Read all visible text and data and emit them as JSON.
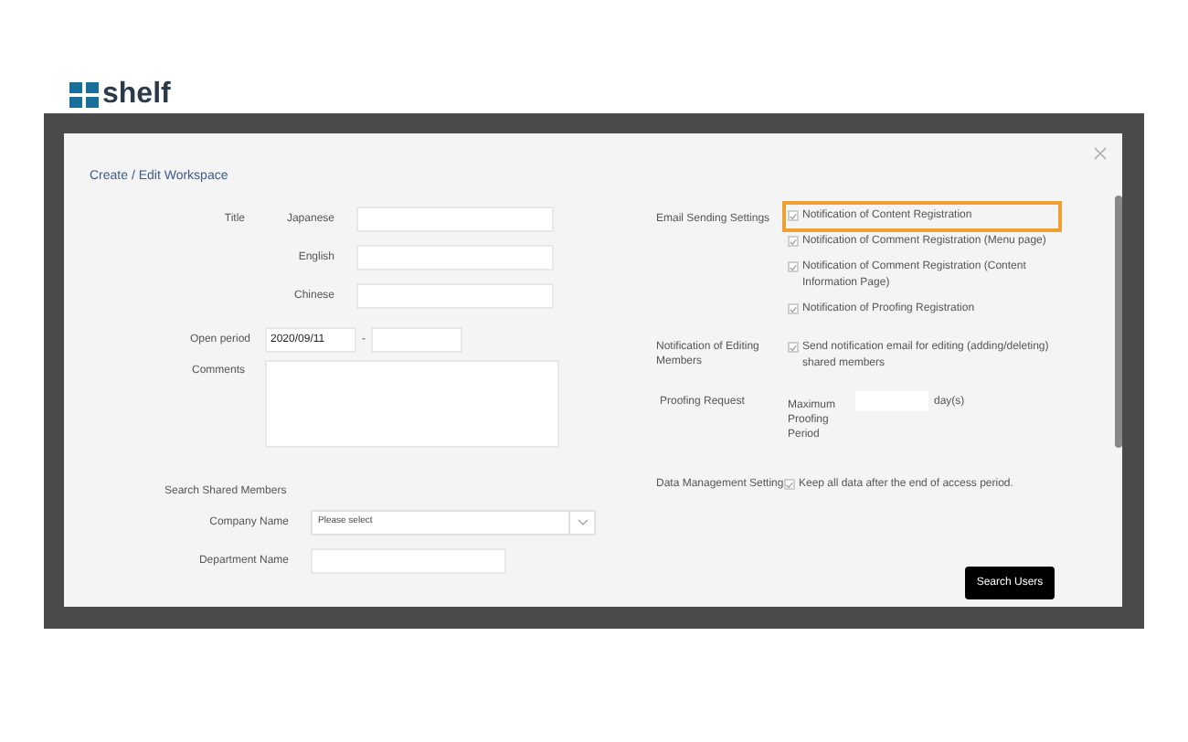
{
  "background_app": {
    "logo": "shelf"
  },
  "dialog": {
    "title": "Create / Edit Workspace",
    "title_field": {
      "label": "Title",
      "languages": [
        {
          "label": "Japanese"
        },
        {
          "label": "English"
        },
        {
          "label": "Chinese"
        }
      ]
    },
    "open_period": {
      "label": "Open period",
      "start": "2020/09/11",
      "separator": "-"
    },
    "comments": {
      "label": "Comments"
    },
    "search_shared_members": {
      "heading": "Search Shared Members",
      "company": {
        "label": "Company Name",
        "value": "Please select"
      },
      "department": {
        "label": "Department Name"
      }
    },
    "email_sending": {
      "label": "Email Sending Settings",
      "options": [
        {
          "label": "Notification of Content Registration",
          "checked": true,
          "highlighted": true
        },
        {
          "label": "Notification of Comment Registration (Menu page)",
          "checked": true,
          "highlighted": false
        },
        {
          "label": "Notification of Comment Registration (Content Information Page)",
          "checked": true,
          "highlighted": false
        },
        {
          "label": "Notification of Proofing Registration",
          "checked": true,
          "highlighted": false
        }
      ]
    },
    "editing_members": {
      "label": "Notification of Editing Members",
      "option": {
        "label": "Send notification email for editing (adding/deleting) shared members",
        "checked": true
      }
    },
    "proofing_request": {
      "label": "Proofing Request",
      "field_label": "Maximum Proofing Period",
      "unit": "day(s)"
    },
    "data_management": {
      "label": "Data Management Setting",
      "option": {
        "label": "Keep all data after the end of access period.",
        "checked": true
      }
    },
    "search_button": "Search Users"
  }
}
